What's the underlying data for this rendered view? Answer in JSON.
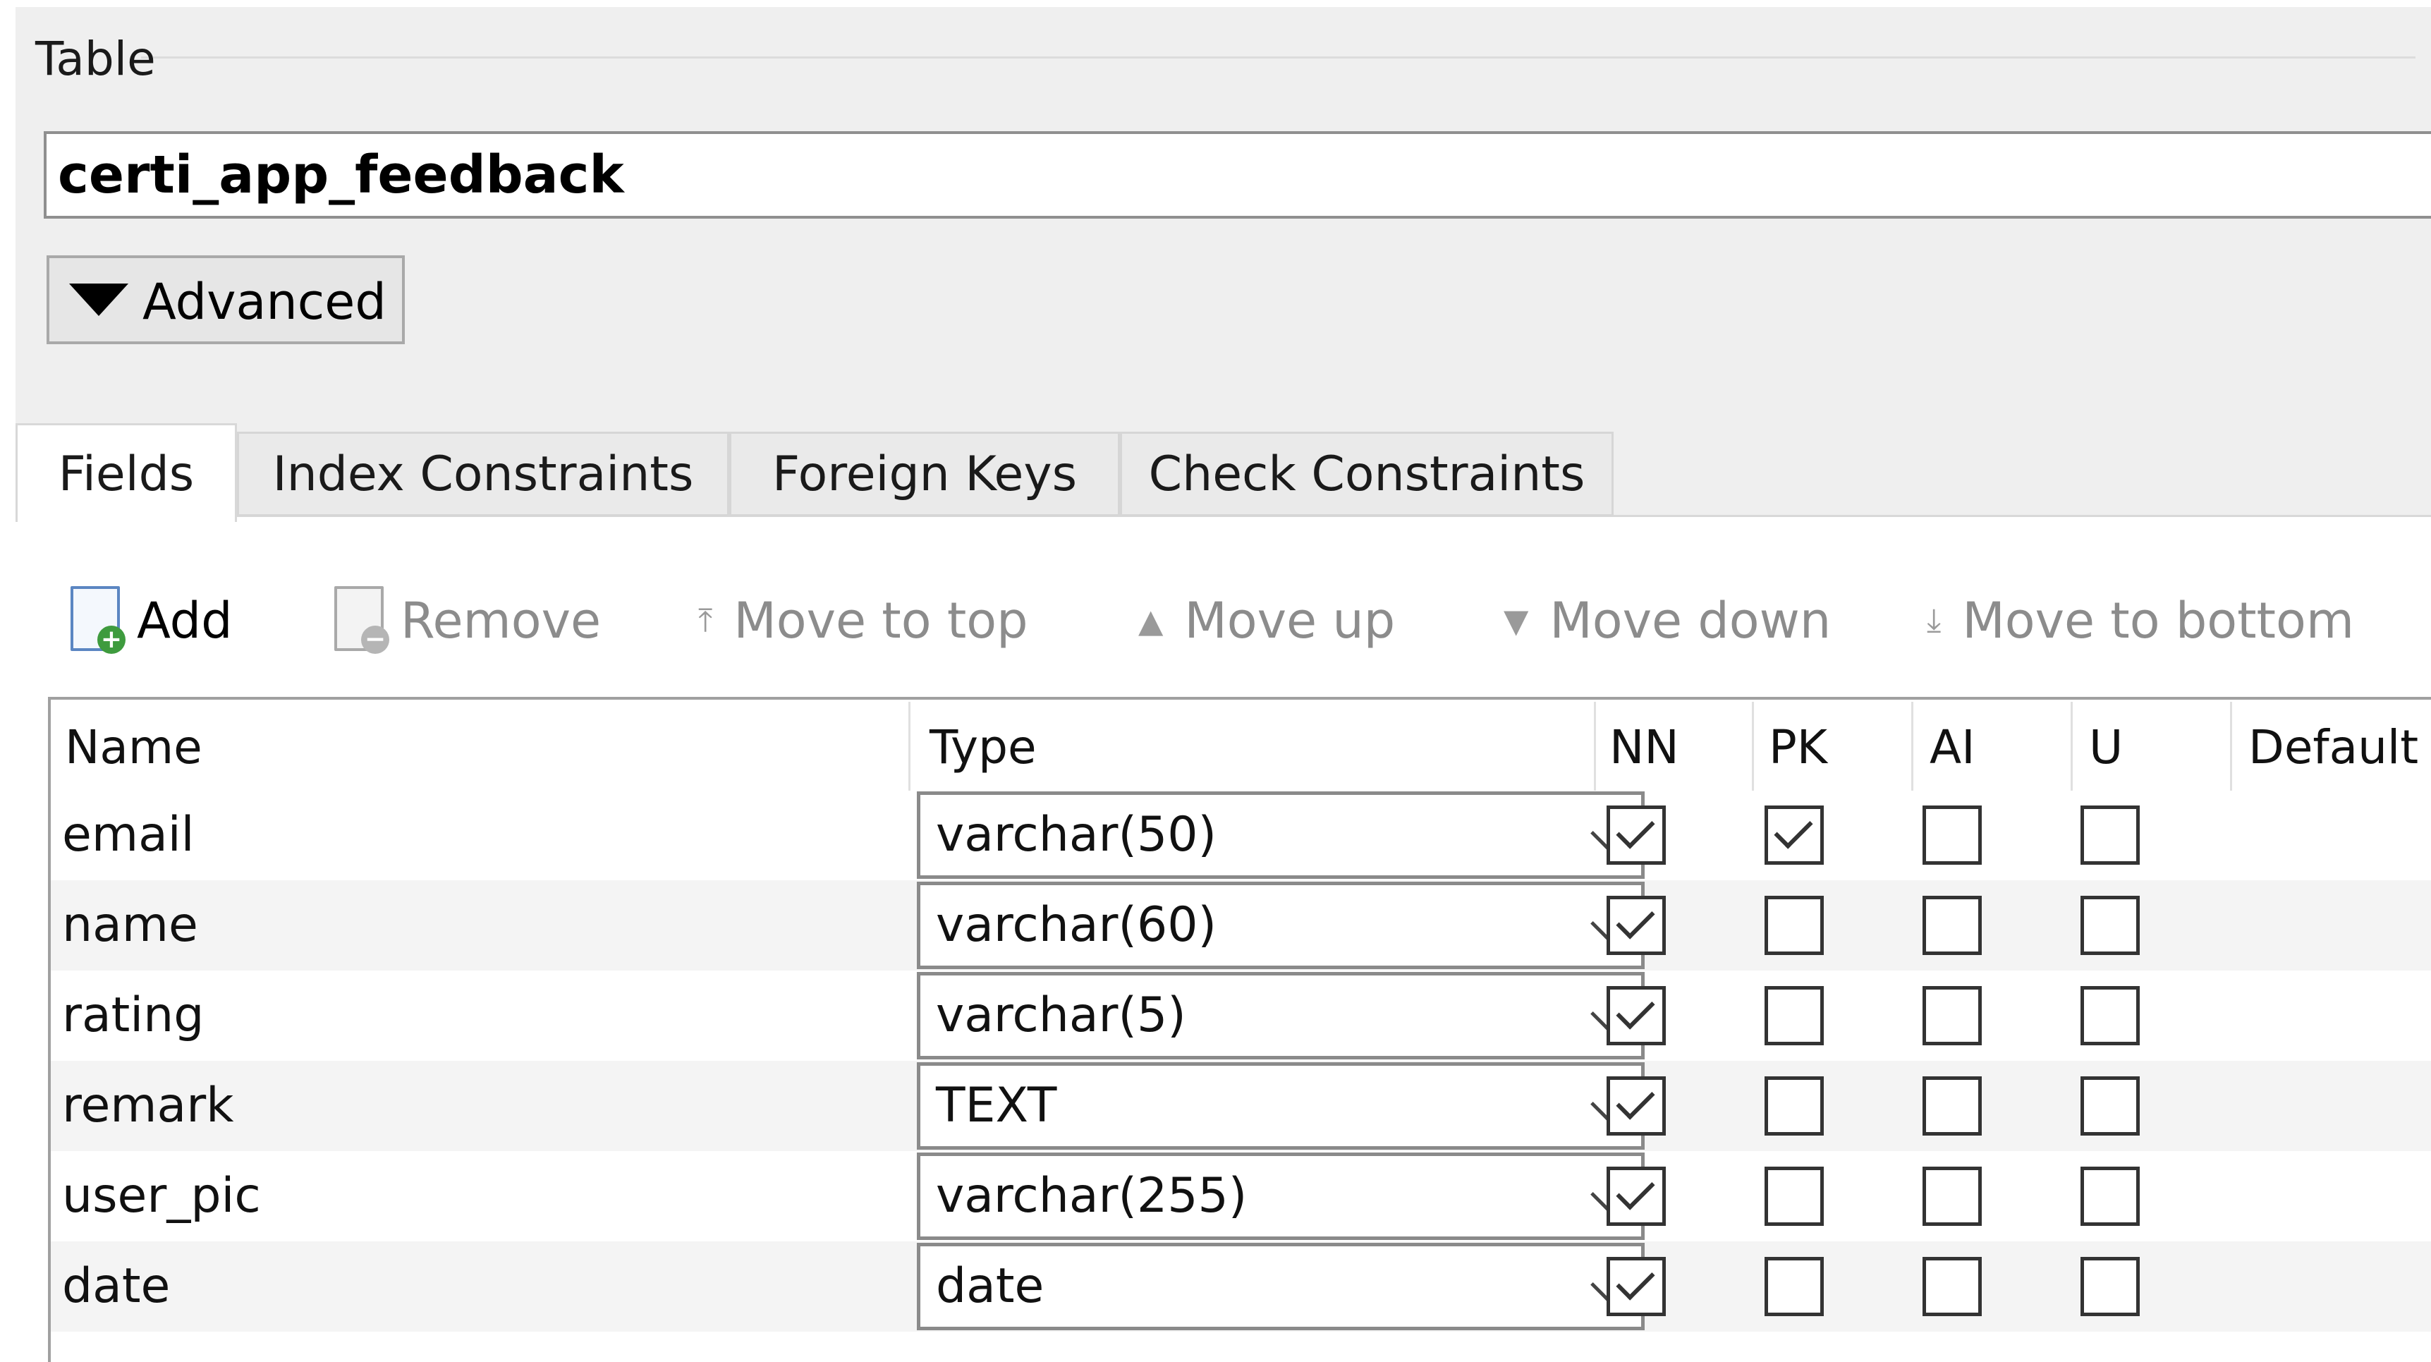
{
  "table_group": {
    "title": "Table",
    "table_name": "certi_app_feedback",
    "advanced_label": "Advanced"
  },
  "tabs": [
    {
      "label": "Fields",
      "active": true
    },
    {
      "label": "Index Constraints",
      "active": false
    },
    {
      "label": "Foreign Keys",
      "active": false
    },
    {
      "label": "Check Constraints",
      "active": false
    }
  ],
  "toolbar": {
    "add": "Add",
    "remove": "Remove",
    "move_to_top": "Move to top",
    "move_up": "Move up",
    "move_down": "Move down",
    "move_to_bottom": "Move to bottom"
  },
  "columns": {
    "name": "Name",
    "type": "Type",
    "nn": "NN",
    "pk": "PK",
    "ai": "AI",
    "u": "U",
    "default": "Default"
  },
  "fields": [
    {
      "name": "email",
      "type": "varchar(50)",
      "nn": true,
      "pk": true,
      "ai": false,
      "u": false
    },
    {
      "name": "name",
      "type": "varchar(60)",
      "nn": true,
      "pk": false,
      "ai": false,
      "u": false
    },
    {
      "name": "rating",
      "type": "varchar(5)",
      "nn": true,
      "pk": false,
      "ai": false,
      "u": false
    },
    {
      "name": "remark",
      "type": "TEXT",
      "nn": true,
      "pk": false,
      "ai": false,
      "u": false
    },
    {
      "name": "user_pic",
      "type": "varchar(255)",
      "nn": true,
      "pk": false,
      "ai": false,
      "u": false
    },
    {
      "name": "date",
      "type": "date",
      "nn": true,
      "pk": false,
      "ai": false,
      "u": false
    }
  ]
}
